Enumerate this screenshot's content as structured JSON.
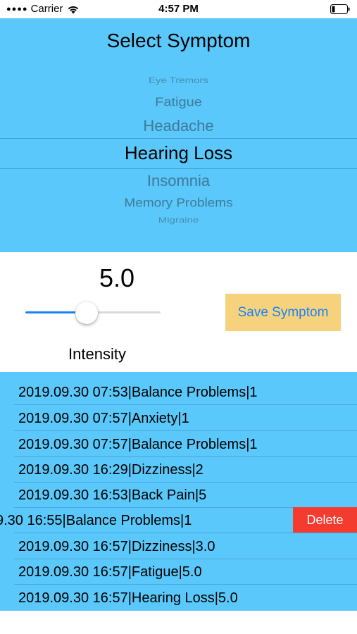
{
  "status_bar": {
    "carrier": "Carrier",
    "time": "4:57 PM",
    "signal_icon": "signal-dots-icon",
    "wifi_icon": "wifi-icon",
    "battery_icon": "battery-low-icon"
  },
  "picker": {
    "title": "Select Symptom",
    "items": [
      "Eye Tremors",
      "Fatigue",
      "Headache",
      "Hearing Loss",
      "Insomnia",
      "Memory Problems",
      "Migraine"
    ],
    "selected": "Hearing Loss"
  },
  "controls": {
    "intensity_value": "5.0",
    "slider_min": 0,
    "slider_max": 10,
    "slider_value": 5.0,
    "intensity_label": "Intensity",
    "save_label": "Save Symptom"
  },
  "log": {
    "entries": [
      "2019.09.30 07:53|Balance Problems|1",
      "2019.09.30 07:57|Anxiety|1",
      "2019.09.30 07:57|Balance Problems|1",
      "2019.09.30 16:29|Dizziness|2",
      "2019.09.30 16:53|Back Pain|5",
      "9.30 16:55|Balance Problems|1",
      "2019.09.30 16:57|Dizziness|3.0",
      "2019.09.30 16:57|Fatigue|5.0",
      "2019.09.30 16:57|Hearing Loss|5.0"
    ],
    "delete_label": "Delete"
  },
  "colors": {
    "panel_blue": "#5ac8fa",
    "button_yellow": "#f7d27d",
    "accent_blue": "#1a82f7",
    "delete_red": "#f33b30"
  }
}
